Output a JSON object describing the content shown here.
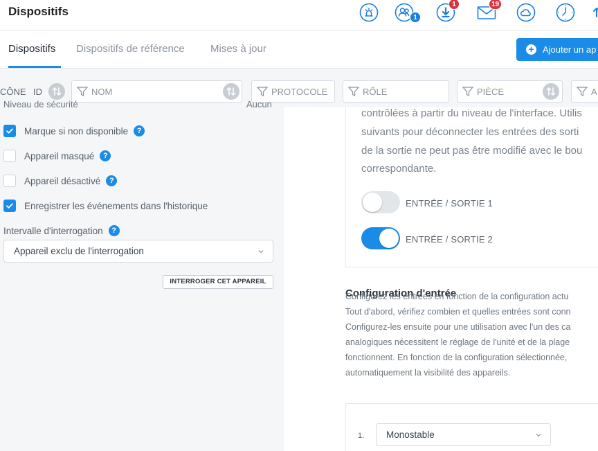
{
  "header": {
    "title": "Dispositifs",
    "users_badge": "1",
    "download_badge": "1",
    "messages_badge": "19"
  },
  "tabs": [
    {
      "label": "Dispositifs",
      "active": true
    },
    {
      "label": "Dispositifs de référence",
      "active": false
    },
    {
      "label": "Mises à jour",
      "active": false
    }
  ],
  "add_button": {
    "label": "Ajouter un ap"
  },
  "filters": {
    "icon_col": "CÔNE",
    "id_col": "ID",
    "name_placeholder": "NOM",
    "protocol_placeholder": "PROTOCOLE",
    "role_placeholder": "RÔLE",
    "room_placeholder": "PIÈCE",
    "cut_placeholder": "A"
  },
  "left_panel": {
    "cut_label_left": "Niveau de sécurité",
    "cut_label_right": "Aucun",
    "checkboxes": [
      {
        "label": "Marque si non disponible",
        "checked": true,
        "help": "?"
      },
      {
        "label": "Appareil masqué",
        "checked": false,
        "help": "?"
      },
      {
        "label": "Appareil désactivé",
        "checked": false,
        "help": "?"
      },
      {
        "label": "Enregistrer les événements dans l'historique",
        "checked": true,
        "help": ""
      }
    ],
    "interval_label": "Intervalle d'interrogation",
    "interval_help": "?",
    "interval_value": "Appareil exclu de l'interrogation",
    "poll_button": "INTERROGER CET APPAREIL"
  },
  "io_card": {
    "lines": [
      "contrôlées à partir du niveau de l'interface. Utilis",
      "suivants pour déconnecter les entrées des sorti",
      "de la sortie ne peut pas être modifié avec le bou",
      "correspondante."
    ],
    "toggles": [
      {
        "label": "ENTRÉE / SORTIE 1",
        "on": false
      },
      {
        "label": "ENTRÉE / SORTIE 2",
        "on": true
      }
    ]
  },
  "input_config": {
    "title": "Configuration d'entrée",
    "lines": [
      "Configurez les entrées en fonction de la configuration actu",
      "Tout d'abord, vérifiez combien et quelles entrées sont conn",
      "Configurez-les ensuite pour une utilisation avec l'un des ca",
      "analogiques nécessitent le réglage de l'unité et de la plage",
      "fonctionnent. En fonction de la configuration sélectionnée,",
      "automatiquement la visibilité des appareils."
    ],
    "row_number": "1.",
    "row_value": "Monostable"
  },
  "colors": {
    "accent": "#1a8ce8",
    "badge_red": "#d9333f",
    "panel_bg": "#f4f6f8"
  }
}
